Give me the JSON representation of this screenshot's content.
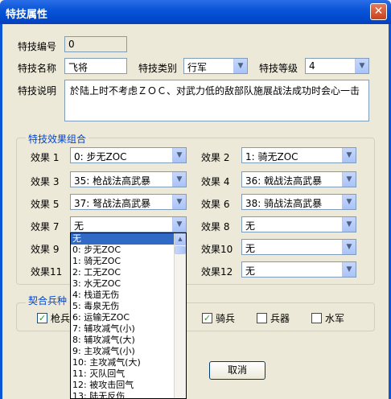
{
  "window": {
    "title": "特技属性",
    "close": "✕"
  },
  "fields": {
    "id_label": "特技编号",
    "id_value": "0",
    "name_label": "特技名称",
    "name_value": "飞将",
    "type_label": "特技类别",
    "type_value": "行军",
    "level_label": "特技等级",
    "level_value": "4",
    "desc_label": "特技说明",
    "desc_value": "於陆上时不考虑ＺＯＣ、对武力低的敌部队施展战法成功时会心一击"
  },
  "effects": {
    "group_title": "特技效果组合",
    "items": [
      {
        "label": "效果 1",
        "value": "0:  步无ZOC"
      },
      {
        "label": "效果 2",
        "value": "1:  骑无ZOC"
      },
      {
        "label": "效果 3",
        "value": "35:  枪战法高武暴"
      },
      {
        "label": "效果 4",
        "value": "36:  戟战法高武暴"
      },
      {
        "label": "效果 5",
        "value": "37:  弩战法高武暴"
      },
      {
        "label": "效果 6",
        "value": "38:  骑战法高武暴"
      },
      {
        "label": "效果 7",
        "value": "无"
      },
      {
        "label": "效果 8",
        "value": "无"
      },
      {
        "label": "效果 9",
        "value": ""
      },
      {
        "label": "效果10",
        "value": "无"
      },
      {
        "label": "效果11",
        "value": ""
      },
      {
        "label": "效果12",
        "value": "无"
      }
    ]
  },
  "troops": {
    "group_title": "契合兵种",
    "items": [
      {
        "label": "枪兵",
        "checked": true
      },
      {
        "label": "骑兵",
        "checked": true
      },
      {
        "label": "兵器",
        "checked": false
      },
      {
        "label": "水军",
        "checked": false
      }
    ]
  },
  "buttons": {
    "cancel": "取消"
  },
  "dropdown": {
    "options": [
      "无",
      "0:  步无ZOC",
      "1:  骑无ZOC",
      "2:  工无ZOC",
      "3:  水无ZOC",
      "4:  栈道无伤",
      "5:  毒泉无伤",
      "6:  运输无ZOC",
      "7:  辅攻减气(小)",
      "8:  辅攻减气(大)",
      "9:  主攻减气(小)",
      "10:  主攻减气(大)",
      "11:  灭队回气",
      "12:  被攻击回气",
      "13:  陆无反伤"
    ],
    "selected_index": 0
  },
  "colors": {
    "title_bar": "#0a55d8",
    "selection": "#316ac5",
    "group_title": "#0046d5"
  }
}
